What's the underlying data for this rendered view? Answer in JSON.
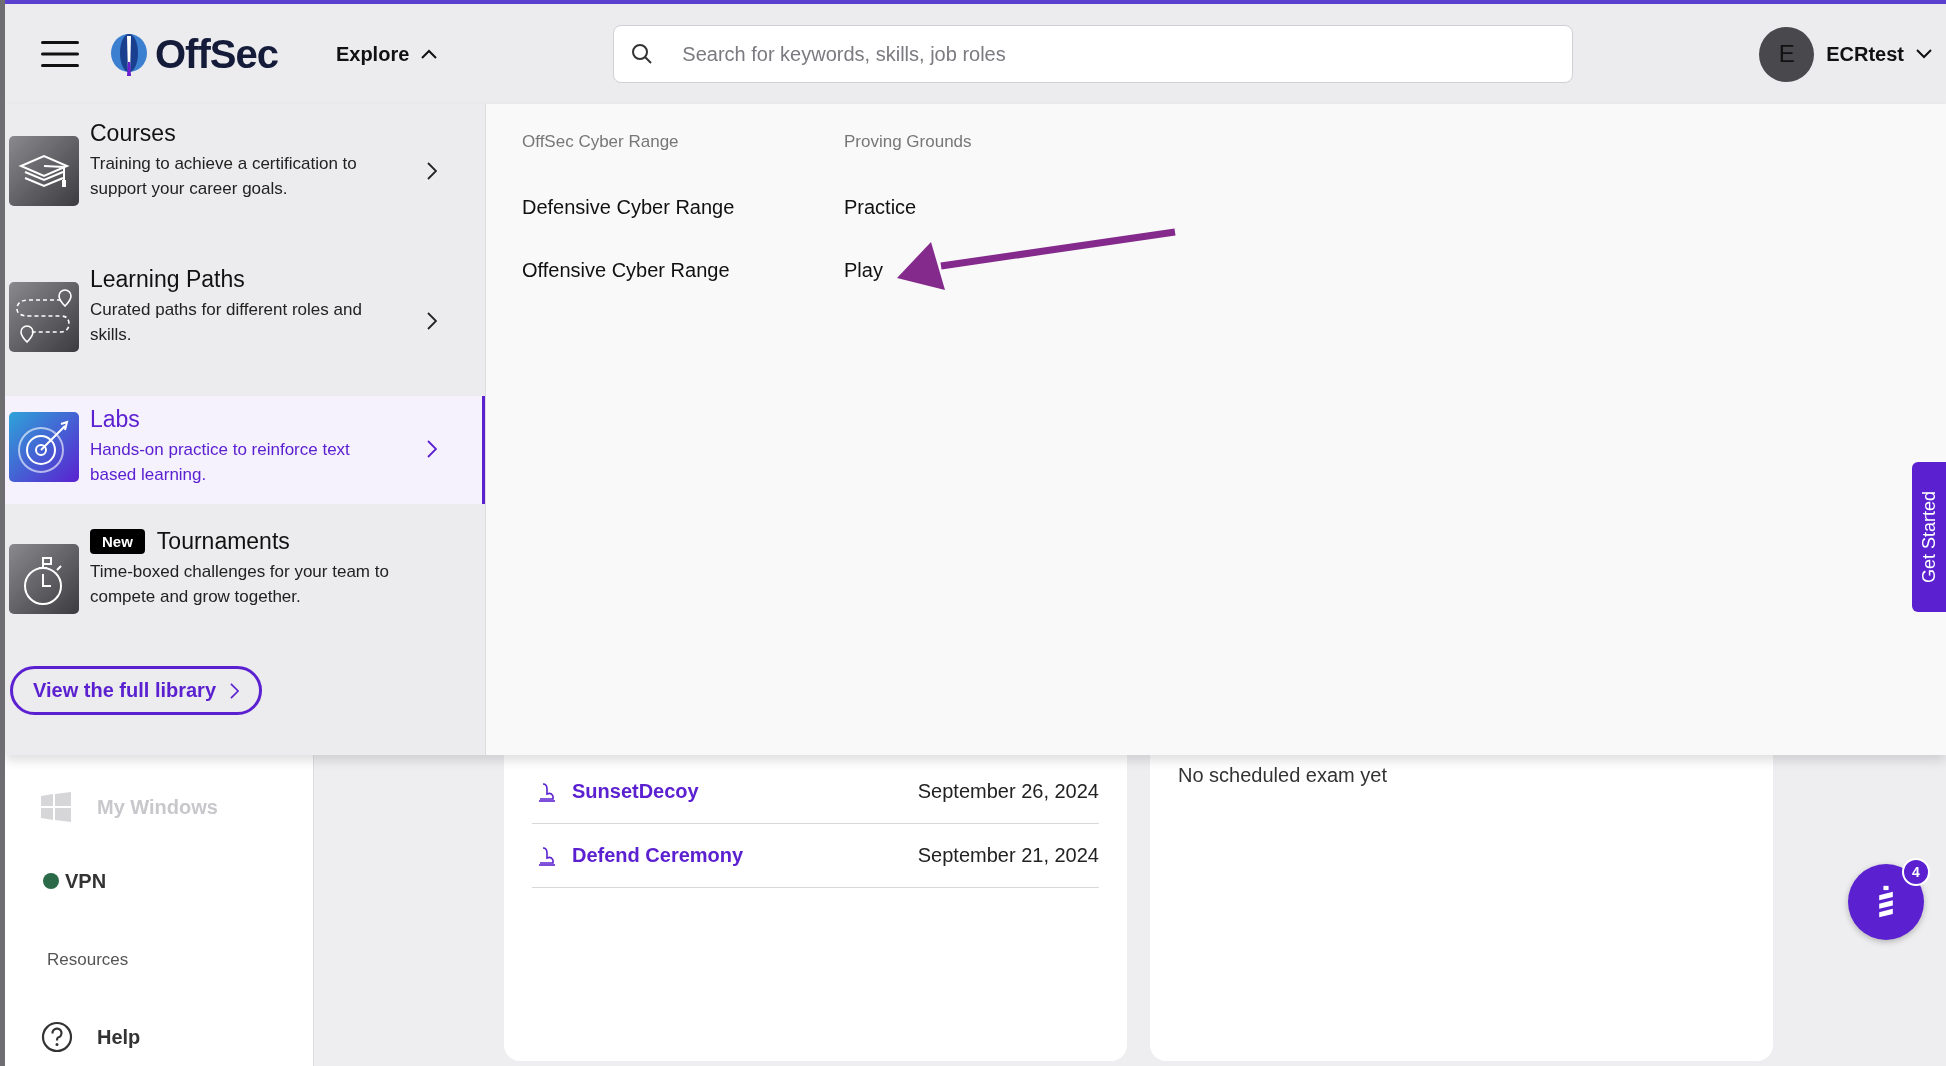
{
  "header": {
    "logo": "OffSec",
    "explore": {
      "label": "Explore",
      "expanded": true
    },
    "search": {
      "placeholder": "Search for keywords, skills, job roles"
    },
    "user": {
      "initial": "E",
      "name": "ECRtest"
    }
  },
  "menu": {
    "categories": [
      {
        "title": "Courses",
        "description": "Training to achieve a certification to support your career goals.",
        "selected": false
      },
      {
        "title": "Learning Paths",
        "description": "Curated paths for different roles and skills.",
        "selected": false
      },
      {
        "title": "Labs",
        "description": "Hands-on practice to reinforce text based learning.",
        "selected": true
      },
      {
        "title": "Tournaments",
        "badge": "New",
        "description": "Time-boxed challenges for your team to compete and grow together.",
        "selected": false
      }
    ],
    "library_button": "View the full library",
    "columns": [
      {
        "heading": "OffSec Cyber Range",
        "links": [
          "Defensive Cyber Range",
          "Offensive Cyber Range"
        ]
      },
      {
        "heading": "Proving Grounds",
        "links": [
          "Practice",
          "Play"
        ]
      }
    ]
  },
  "sidebar": {
    "items": [
      {
        "kind": "windows",
        "label": "My Windows",
        "disabled": true
      },
      {
        "kind": "vpn",
        "label": "VPN",
        "connected": true
      },
      {
        "kind": "heading",
        "label": "Resources"
      },
      {
        "kind": "help",
        "label": "Help",
        "disabled": false
      }
    ]
  },
  "exams_card": {
    "rows": [
      {
        "name": "SunsetDecoy",
        "date": "September 26, 2024"
      },
      {
        "name": "Defend Ceremony",
        "date": "September 21, 2024"
      }
    ]
  },
  "schedule_card": {
    "message": "No scheduled exam yet"
  },
  "get_started": "Get Started",
  "chat": {
    "badge": "4"
  }
}
